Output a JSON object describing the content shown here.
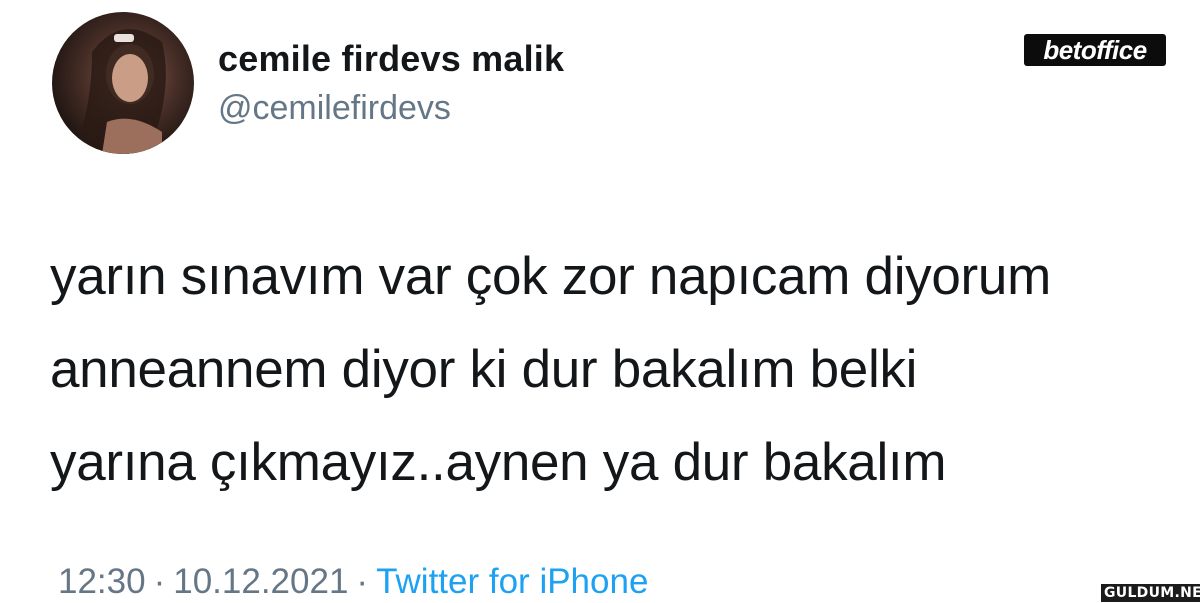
{
  "user": {
    "display_name": "cemile firdevs malik",
    "handle": "@cemilefirdevs"
  },
  "tweet": {
    "lines": [
      "yarın sınavım var çok zor napıcam diyorum",
      "anneannem diyor ki dur bakalım belki",
      "yarına çıkmayız..aynen ya dur bakalım"
    ]
  },
  "meta": {
    "time": "12:30",
    "date": "10.12.2021",
    "separator": "·",
    "source": "Twitter for iPhone"
  },
  "brand": {
    "logo_text": "betoffice"
  },
  "watermark": {
    "text": "GULDUM.NET"
  },
  "colors": {
    "text": "#14171a",
    "muted": "#657786",
    "link": "#1da1f2"
  }
}
